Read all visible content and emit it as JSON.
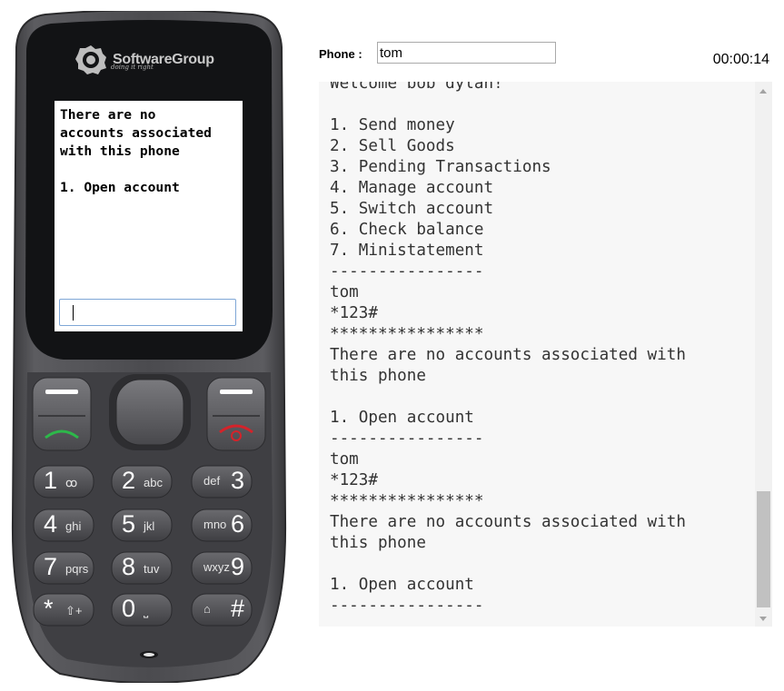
{
  "phone": {
    "brand": {
      "name": "SoftwareGroup",
      "tagline": "doing it right"
    },
    "screen": {
      "text": "There are no\naccounts associated\nwith this phone\n\n1. Open account",
      "input_value": ""
    },
    "keys": [
      {
        "num": "1",
        "sub": "ꝏ"
      },
      {
        "num": "2",
        "sub": "abc"
      },
      {
        "num": "3",
        "sub": "def"
      },
      {
        "num": "4",
        "sub": "ghi"
      },
      {
        "num": "5",
        "sub": "jkl"
      },
      {
        "num": "6",
        "sub": "mno"
      },
      {
        "num": "7",
        "sub": "pqrs"
      },
      {
        "num": "8",
        "sub": "tuv"
      },
      {
        "num": "9",
        "sub": "wxyz"
      },
      {
        "num": "*",
        "sub": "⇧+"
      },
      {
        "num": "0",
        "sub": "⎵"
      },
      {
        "num": "#",
        "sub": "⌂"
      }
    ],
    "colors": {
      "body": "#4a4a4e",
      "bezel": "#111214",
      "call": "#2db84a",
      "end": "#d4232a"
    }
  },
  "session": {
    "phone_label": "Phone :",
    "phone_value": "tom",
    "timer": "00:00:14"
  },
  "console": {
    "text": "Welcome bob dylan!\n\n1. Send money\n2. Sell Goods\n3. Pending Transactions\n4. Manage account\n5. Switch account\n6. Check balance\n7. Ministatement\n----------------\ntom\n*123#\n****************\nThere are no accounts associated with\nthis phone\n\n1. Open account\n----------------\ntom\n*123#\n****************\nThere are no accounts associated with\nthis phone\n\n1. Open account\n----------------"
  }
}
